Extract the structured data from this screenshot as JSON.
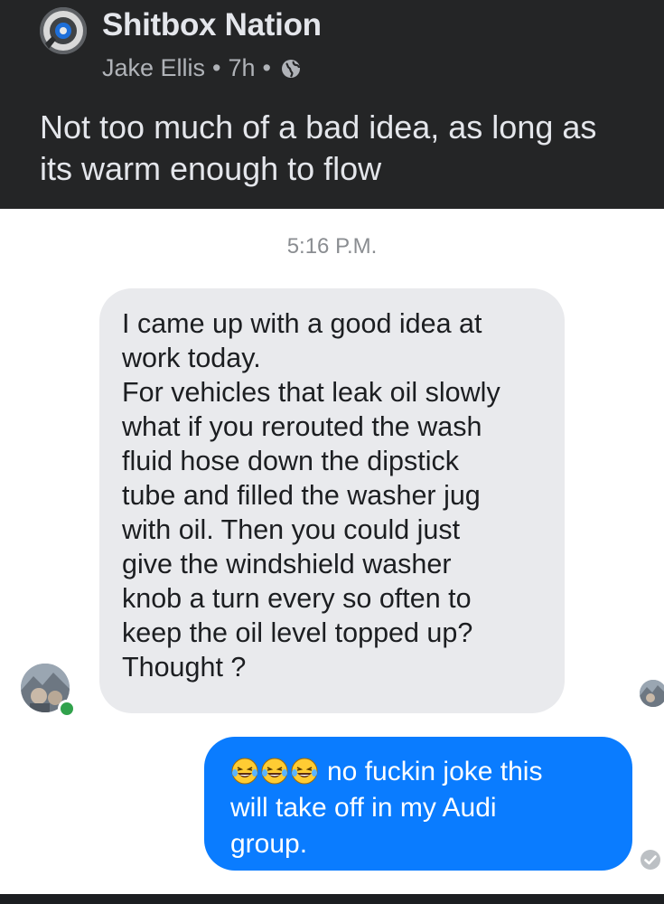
{
  "post": {
    "group_name": "Shitbox Nation",
    "author": "Jake Ellis",
    "separator": "•",
    "time": "7h",
    "privacy_icon": "globe-icon",
    "text": "Not too much of a bad idea, as long as its warm enough to flow",
    "text_lines": [
      "Not too much of a bad idea, as long as",
      "its warm enough to flow"
    ]
  },
  "thread": {
    "timestamp": "5:16 P.M.",
    "incoming": {
      "lines": [
        "I came up with a good idea at",
        "work today.",
        "For vehicles that leak oil slowly",
        "what if you rerouted the wash",
        "fluid hose down the dipstick",
        "tube and filled the washer jug",
        "with oil. Then you could just",
        "give the windshield washer",
        "knob a turn every so often to",
        "keep the oil level topped up?",
        "Thought ?"
      ],
      "online": true
    },
    "outgoing": {
      "emoji": [
        "laughing-crying-emoji",
        "laughing-crying-emoji",
        "laughing-crying-emoji"
      ],
      "first_line_text": "no fuckin joke this",
      "lines": [
        "will take off in my Audi",
        "group."
      ],
      "status_icon": "delivered-check-icon"
    }
  },
  "colors": {
    "header_bg": "#242526",
    "outgoing_bubble": "#0a7cff",
    "incoming_bubble": "#e9eaed",
    "online_dot": "#31a24c"
  }
}
